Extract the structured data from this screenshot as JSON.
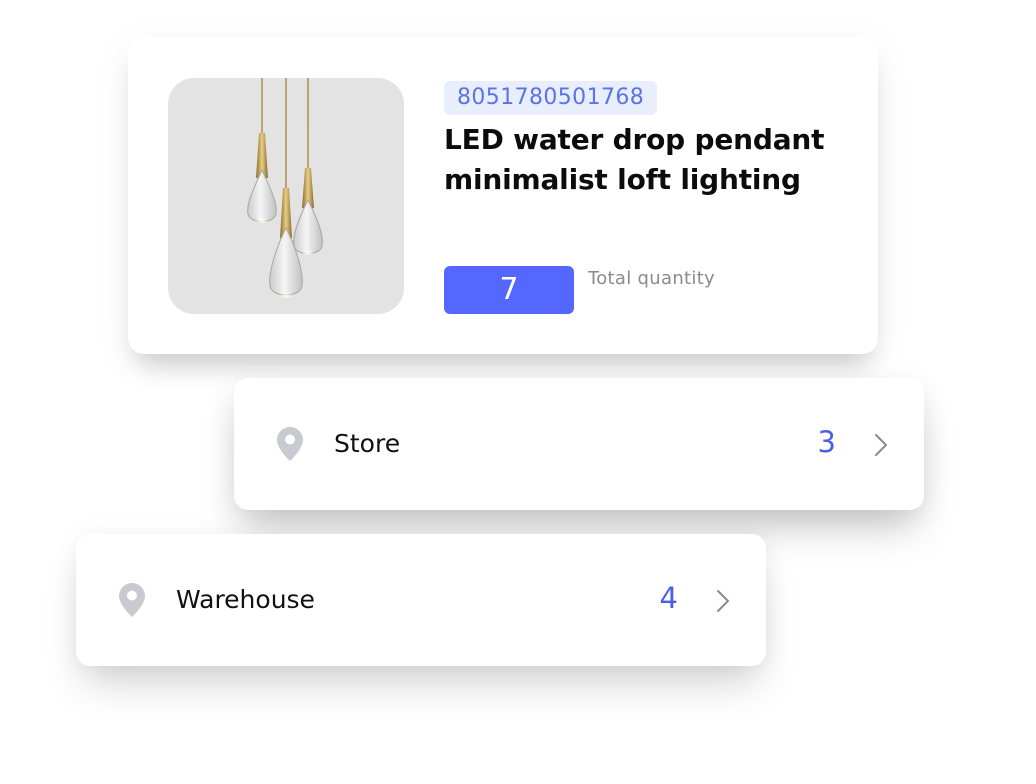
{
  "product": {
    "image_icon": "pendant-lamp-image",
    "barcode": "8051780501768",
    "title": "LED water drop pendant minimalist loft lighting",
    "total_quantity": "7",
    "total_quantity_label": "Total quantity"
  },
  "locations": [
    {
      "name": "Store",
      "count": "3",
      "icon": "location-pin-icon",
      "chevron": "chevron-right-icon"
    },
    {
      "name": "Warehouse",
      "count": "4",
      "icon": "location-pin-icon",
      "chevron": "chevron-right-icon"
    }
  ],
  "colors": {
    "accent": "#5468ff",
    "count_text": "#4a60e6",
    "badge_bg": "#e8eefc",
    "badge_text": "#5b73e8",
    "muted_text": "#8a8a8f",
    "pin_gray": "#c9c9d1",
    "image_bg": "#e3e3e3"
  }
}
